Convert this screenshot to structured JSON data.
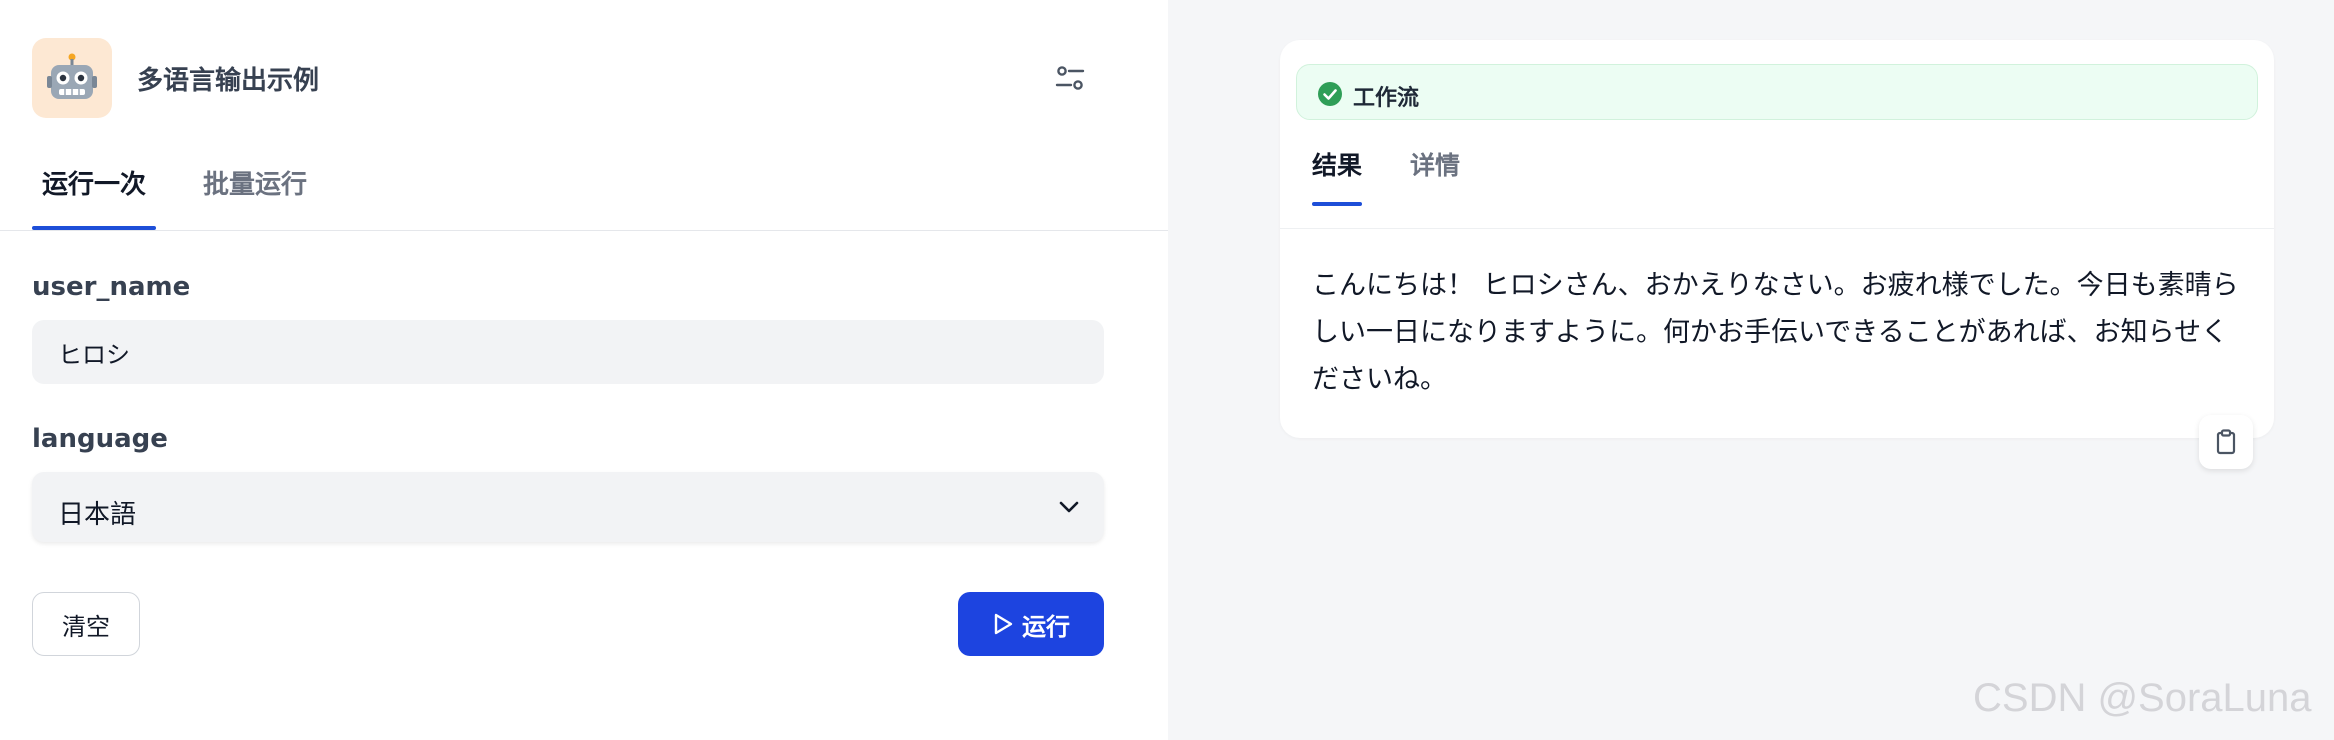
{
  "app": {
    "title": "多语言输出示例",
    "icon": "robot-face-icon"
  },
  "tabs": [
    {
      "label": "运行一次",
      "active": true
    },
    {
      "label": "批量运行",
      "active": false
    }
  ],
  "form": {
    "user_name": {
      "label": "user_name",
      "value": "ヒロシ"
    },
    "language": {
      "label": "language",
      "value": "日本語"
    },
    "clear_label": "清空",
    "run_label": "运行"
  },
  "result_panel": {
    "status": "工作流",
    "status_color": "#2f9e57",
    "tabs": [
      {
        "label": "结果",
        "active": true
      },
      {
        "label": "详情",
        "active": false
      }
    ],
    "text": "こんにちは！ ヒロシさん、おかえりなさい。お疲れ様でした。今日も素晴らしい一日になりますように。何かお手伝いできることがあれば、お知らせくださいね。"
  },
  "watermark": "CSDN @SoraLuna",
  "colors": {
    "accent": "#1d44e0",
    "right_bg": "#f5f6f8",
    "icon_bg": "#fde8d3"
  }
}
